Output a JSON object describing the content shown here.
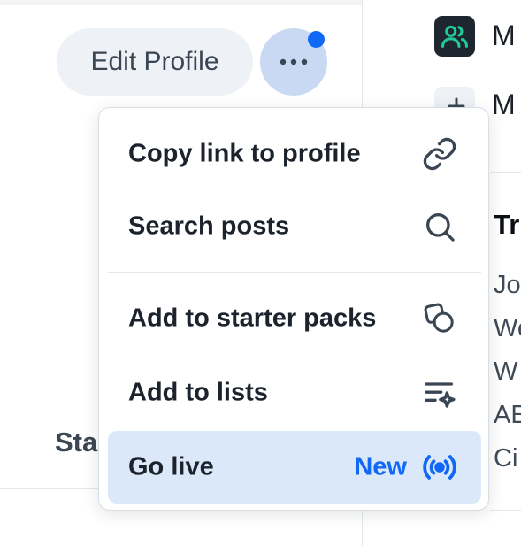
{
  "profile": {
    "edit_label": "Edit Profile",
    "stats_fragment": "Sta"
  },
  "right_column": {
    "items": [
      {
        "label": "M",
        "icon": "people-icon"
      },
      {
        "label": "M",
        "icon": "plus-icon"
      }
    ],
    "trending_title": "Tr",
    "trending": [
      "Jo",
      "We",
      "W",
      "AE",
      "Ci"
    ]
  },
  "menu": {
    "items": [
      {
        "label": "Copy link to profile",
        "icon": "link-icon"
      },
      {
        "label": "Search posts",
        "icon": "search-icon"
      },
      {
        "label": "Add to starter packs",
        "icon": "starter-pack-icon"
      },
      {
        "label": "Add to lists",
        "icon": "list-add-icon"
      },
      {
        "label": "Go live",
        "badge": "New",
        "icon": "broadcast-icon",
        "highlighted": true
      }
    ]
  },
  "colors": {
    "accent": "#1068f5",
    "highlight_bg": "#dbe8fa",
    "feeds_icon_bg": "#1e2630",
    "feeds_icon_fg": "#20c997"
  }
}
